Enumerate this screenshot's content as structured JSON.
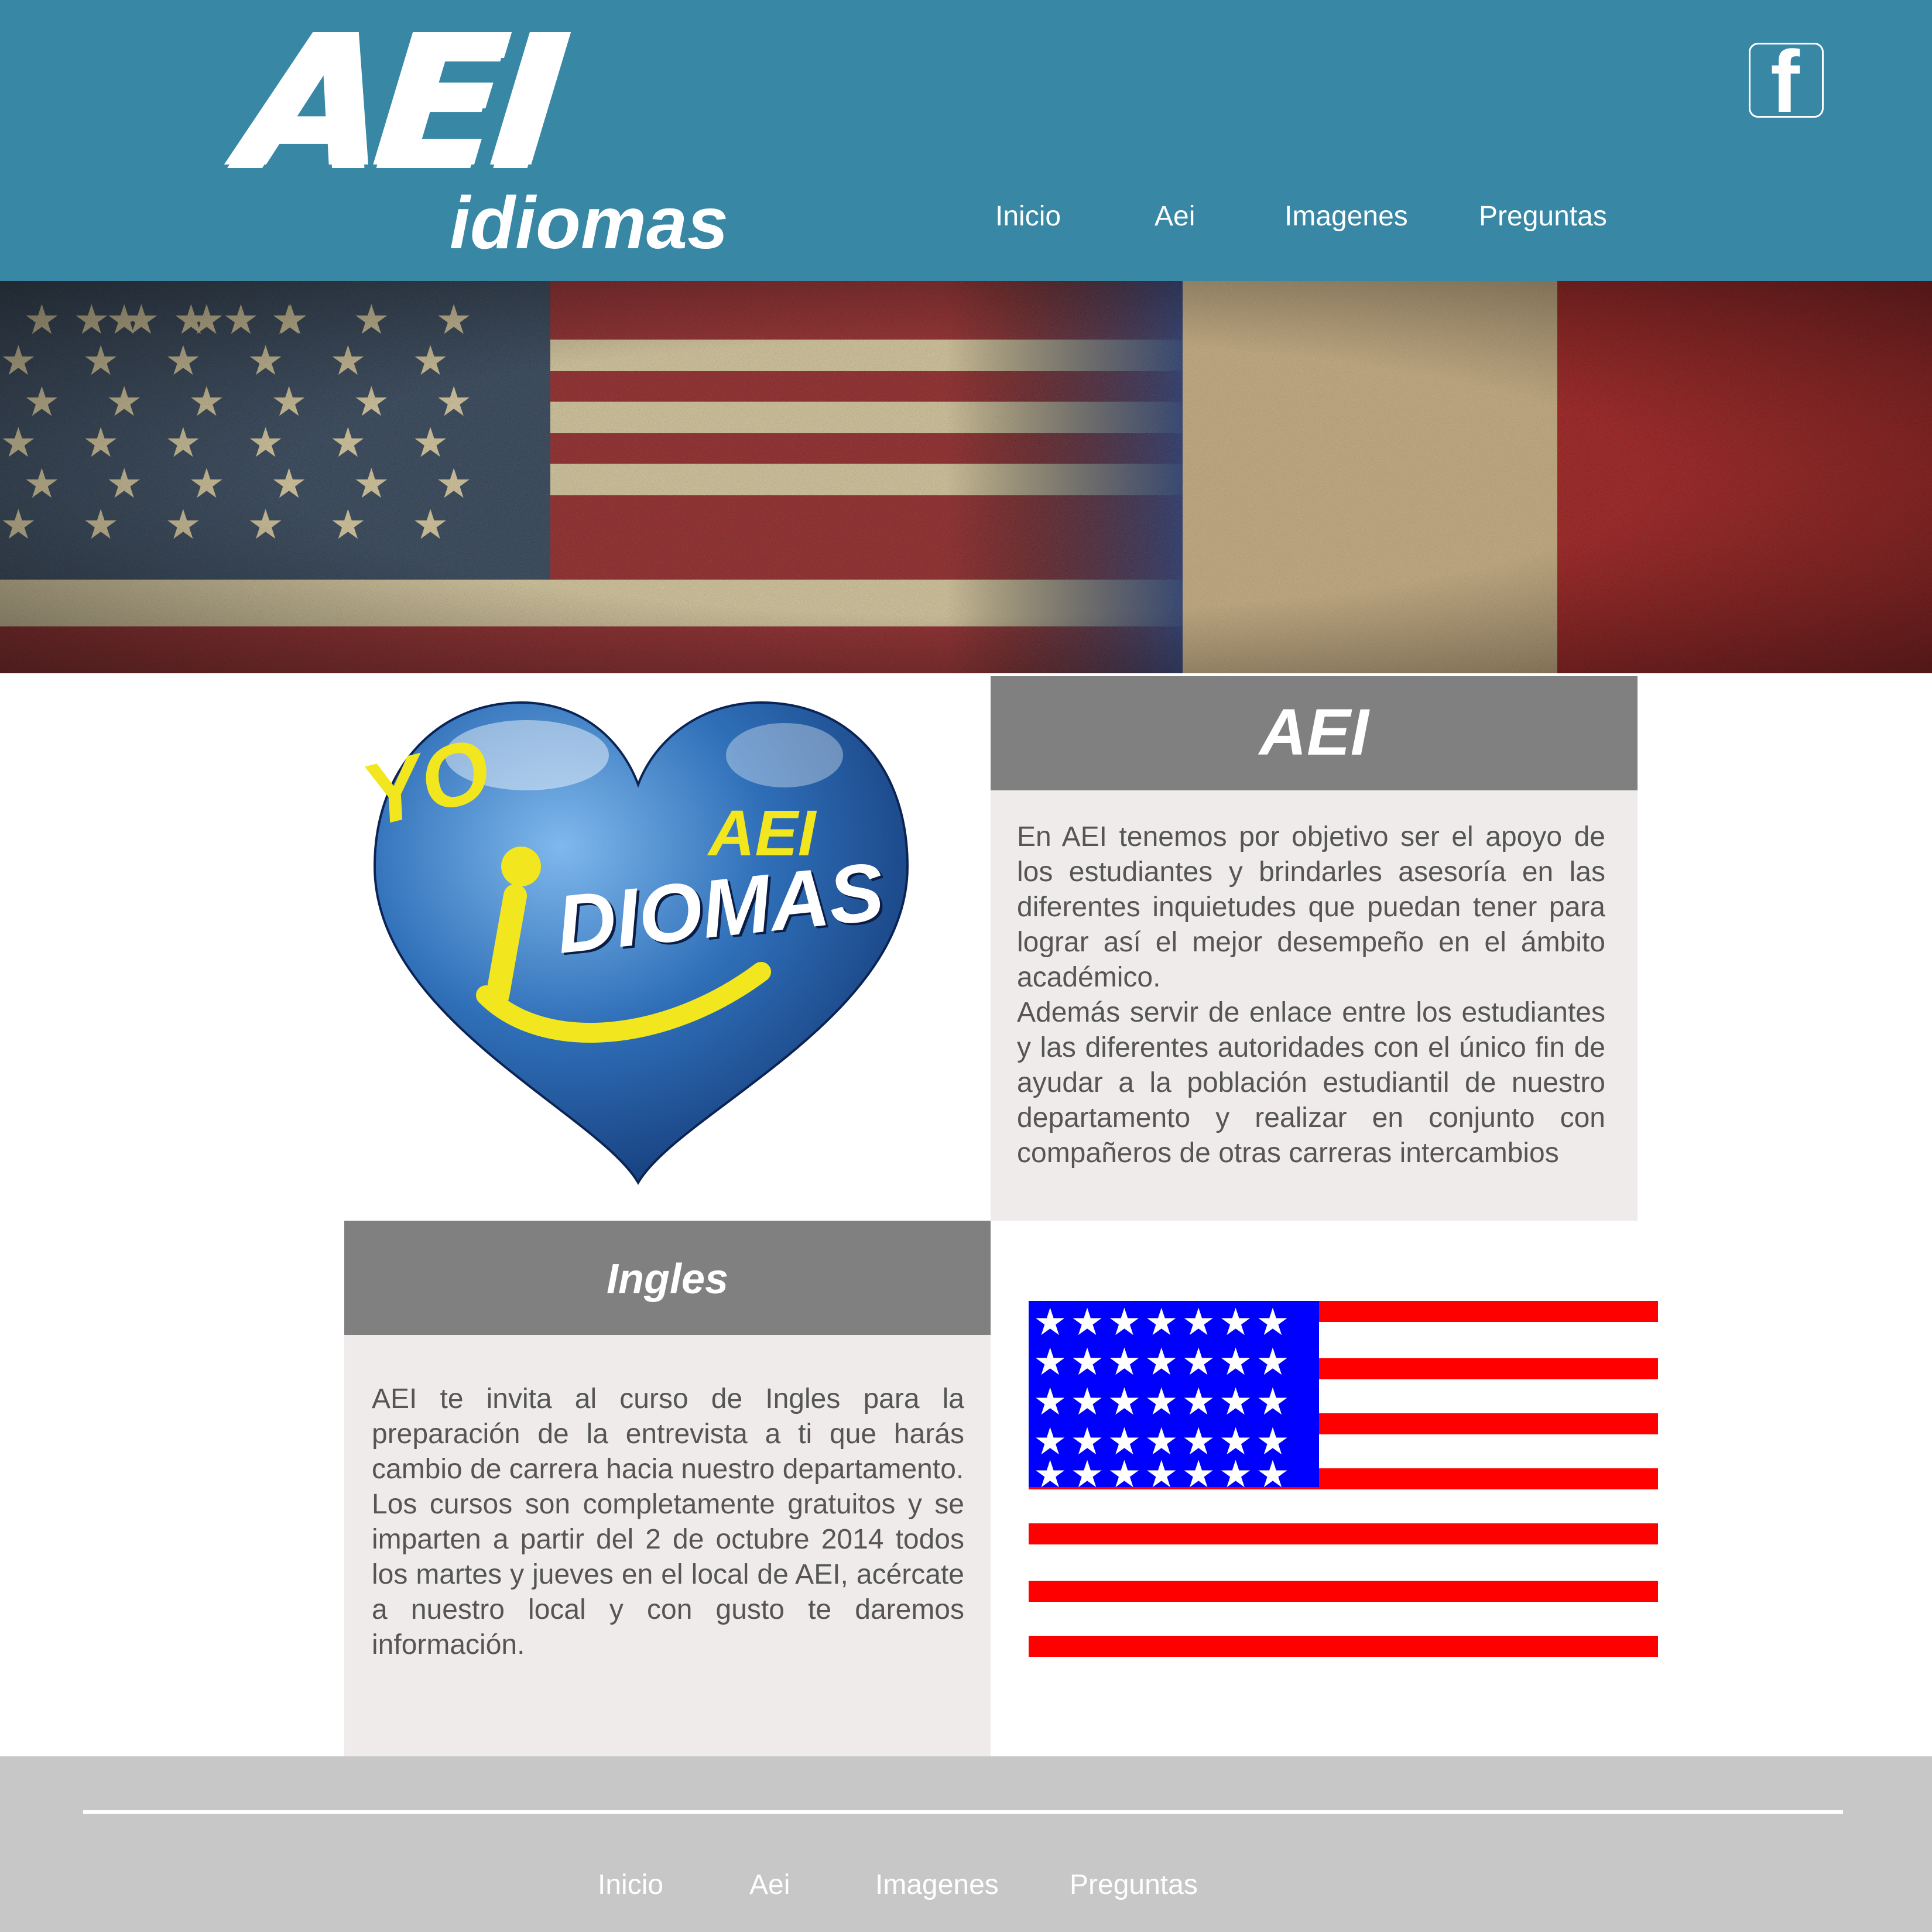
{
  "brand": {
    "logo_main": "AEI",
    "logo_sub": "idiomas"
  },
  "header": {
    "nav": [
      {
        "label": "Inicio"
      },
      {
        "label": "Aei"
      },
      {
        "label": "Imagenes"
      },
      {
        "label": "Preguntas"
      }
    ],
    "social_icon": "facebook-icon",
    "social_glyph": "f"
  },
  "banner": {
    "flags": [
      "us-flag-grunge",
      "france-flag-grunge"
    ]
  },
  "logo_heart": {
    "word_yo": "YO",
    "word_aei": "AEI",
    "word_diomas": "DIOMAS",
    "icon": "heart-icon"
  },
  "aei_panel": {
    "title": "AEI",
    "body": "En AEI tenemos por objetivo ser el apoyo de los estudiantes y brindarles asesoría en las diferentes inquietudes que puedan tener para lograr así el mejor desempeño en el ámbito académico.\nAdemás servir de enlace entre los estudiantes y las diferentes autoridades con el único fin de ayudar a la población estudiantil de nuestro departamento y realizar en conjunto con compañeros de otras carreras intercambios"
  },
  "ingles_panel": {
    "title": "Ingles",
    "body": "AEI te invita al curso de Ingles para la preparación de la entrevista a ti que harás cambio de carrera hacia nuestro departamento.\nLos cursos son completamente gratuitos y se imparten a partir del 2 de octubre 2014 todos los martes y jueves en el local de AEI, acércate a nuestro local y con gusto te daremos información."
  },
  "footer": {
    "nav": [
      {
        "label": "Inicio"
      },
      {
        "label": "Aei"
      },
      {
        "label": "Imagenes"
      },
      {
        "label": "Preguntas"
      }
    ]
  },
  "colors": {
    "header_bg": "#3787a5",
    "panel_header": "#808080",
    "panel_body": "#efebea",
    "footer_bg": "#c8c7c8",
    "flag_red": "#ff0000",
    "flag_blue": "#0000ff"
  }
}
